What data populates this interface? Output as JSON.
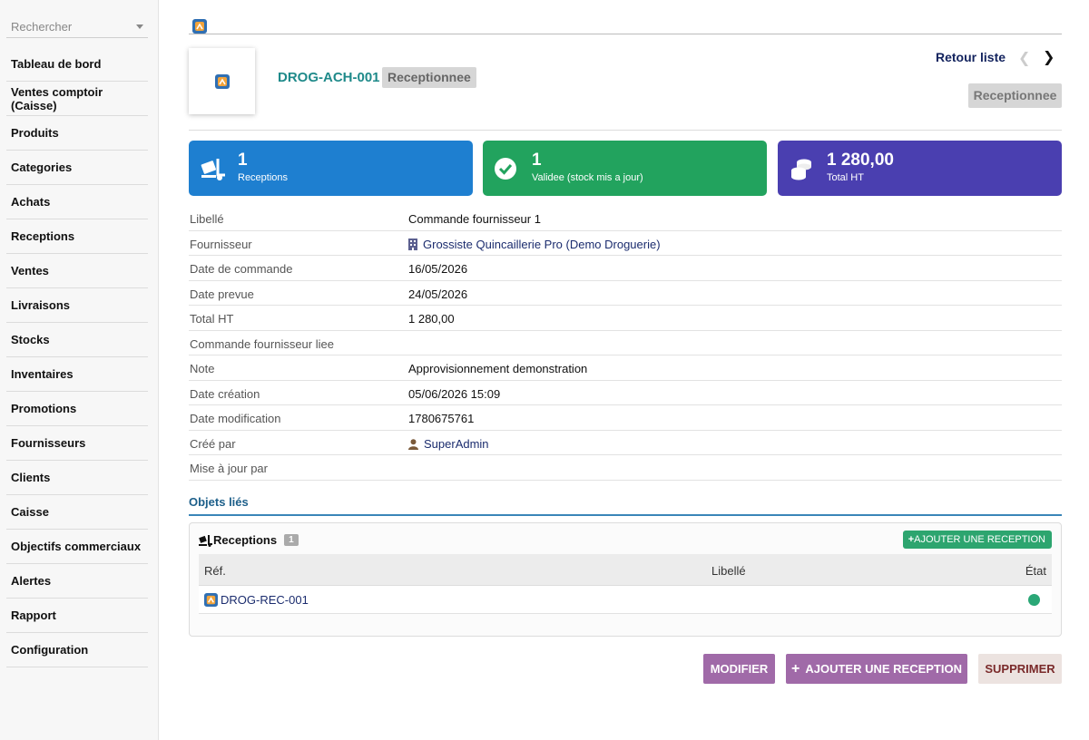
{
  "sidebar": {
    "search_placeholder": "Rechercher",
    "items": [
      {
        "label": "Tableau de bord"
      },
      {
        "label": "Ventes comptoir (Caisse)"
      },
      {
        "label": "Produits"
      },
      {
        "label": "Categories"
      },
      {
        "label": "Achats"
      },
      {
        "label": "Receptions"
      },
      {
        "label": "Ventes"
      },
      {
        "label": "Livraisons"
      },
      {
        "label": "Stocks"
      },
      {
        "label": "Inventaires"
      },
      {
        "label": "Promotions"
      },
      {
        "label": "Fournisseurs"
      },
      {
        "label": "Clients"
      },
      {
        "label": "Caisse"
      },
      {
        "label": "Objectifs commerciaux"
      },
      {
        "label": "Alertes"
      },
      {
        "label": "Rapport"
      },
      {
        "label": "Configuration"
      }
    ]
  },
  "header": {
    "ref": "DROG-ACH-001",
    "status": "Receptionnee",
    "back_label": "Retour liste",
    "status_button": "Receptionnee"
  },
  "cards": [
    {
      "value": "1",
      "label": "Receptions",
      "color": "#1e7fd0"
    },
    {
      "value": "1",
      "label": "Validee (stock mis a jour)",
      "color": "#22a35e"
    },
    {
      "value": "1 280,00",
      "label": "Total HT",
      "color": "#4a3fb0"
    }
  ],
  "properties": [
    {
      "key": "Libellé",
      "value": "Commande fournisseur 1"
    },
    {
      "key": "Fournisseur",
      "value": "Grossiste Quincaillerie Pro (Demo Droguerie)"
    },
    {
      "key": "Date de commande",
      "value": "16/05/2026"
    },
    {
      "key": "Date prevue",
      "value": "24/05/2026"
    },
    {
      "key": "Total HT",
      "value": "1 280,00"
    },
    {
      "key": "Commande fournisseur liee",
      "value": ""
    },
    {
      "key": "Note",
      "value": "Approvisionnement demonstration"
    },
    {
      "key": "Date création",
      "value": "05/06/2026 15:09"
    },
    {
      "key": "Date modification",
      "value": "1780675761"
    },
    {
      "key": "Créé par",
      "value": "SuperAdmin"
    },
    {
      "key": "Mise à jour par",
      "value": ""
    }
  ],
  "linked": {
    "title": "Objets liés",
    "section_label": "Receptions",
    "count": "1",
    "add_label": "AJOUTER UNE RECEPTION",
    "columns": {
      "ref": "Réf.",
      "label": "Libellé",
      "state": "État"
    },
    "rows": [
      {
        "ref": "DROG-REC-001",
        "label": "",
        "state_color": "#2aa776"
      }
    ]
  },
  "actions": {
    "modify": "MODIFIER",
    "add_reception": "AJOUTER UNE RECEPTION",
    "delete": "SUPPRIMER"
  }
}
